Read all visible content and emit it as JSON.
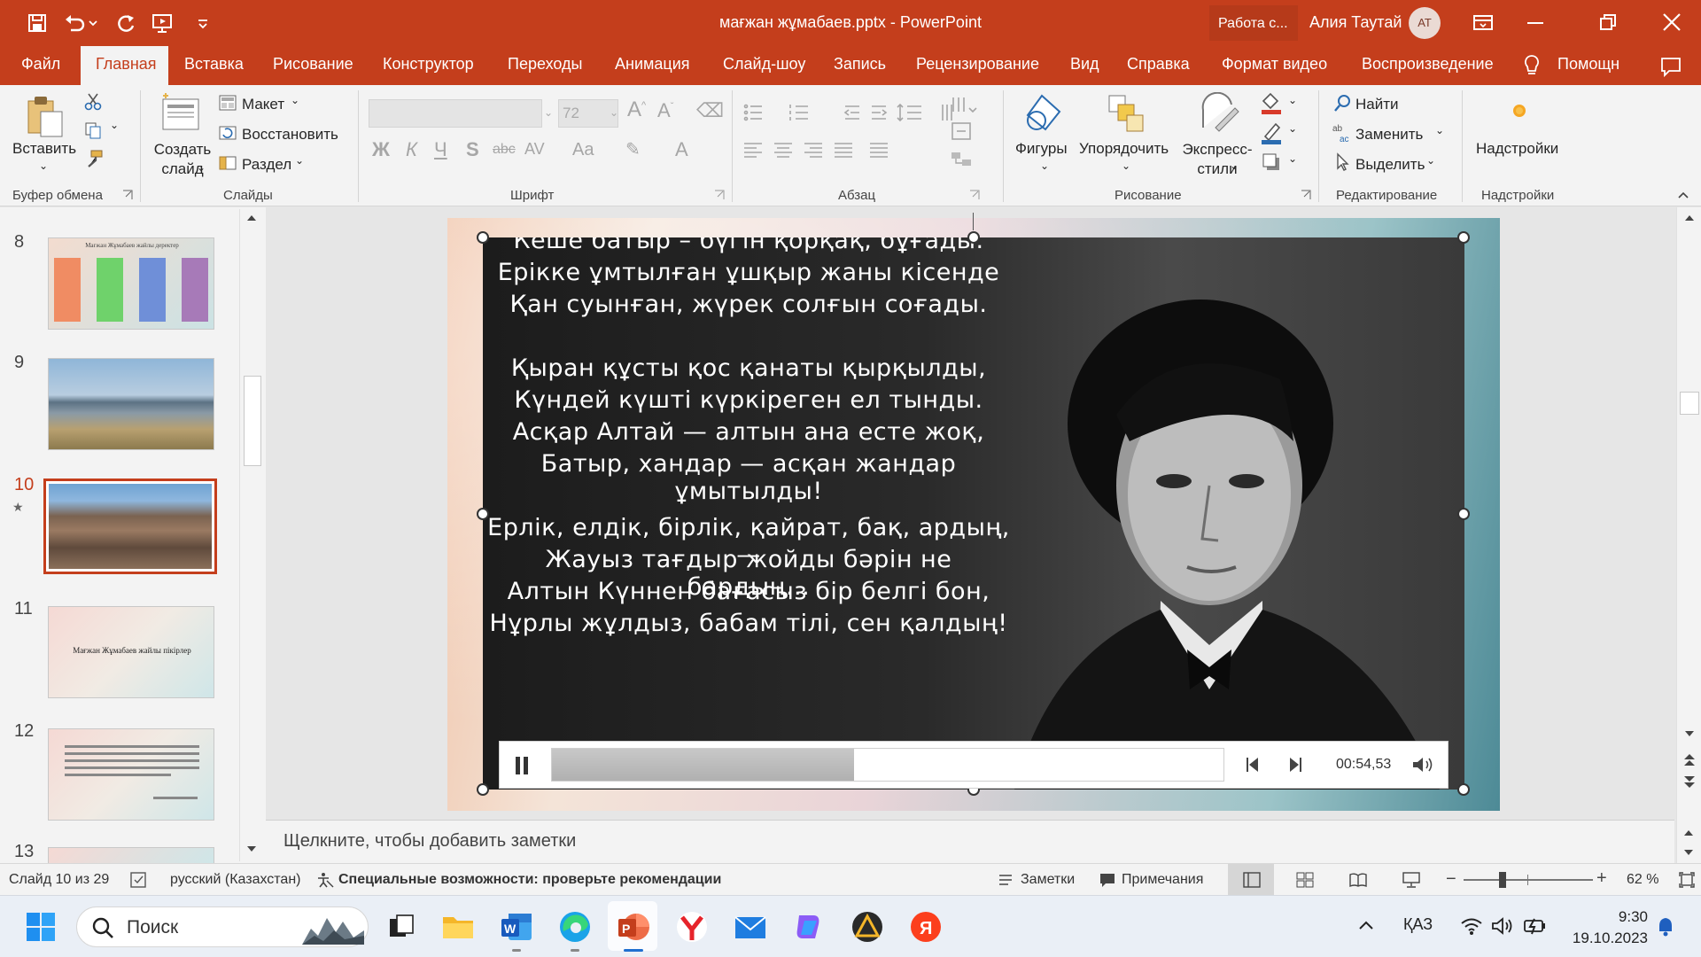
{
  "window": {
    "title": "мағжан жұмабаев.pptx  -  PowerPoint",
    "work_status": "Работа с...",
    "user_name": "Алия Таутай",
    "user_initials": "АТ"
  },
  "tabs": [
    "Файл",
    "Главная",
    "Вставка",
    "Рисование",
    "Конструктор",
    "Переходы",
    "Анимация",
    "Слайд-шоу",
    "Запись",
    "Рецензирование",
    "Вид",
    "Справка",
    "Формат видео",
    "Воспроизведение",
    "Помощн"
  ],
  "ribbon": {
    "clipboard": {
      "paste": "Вставить",
      "label": "Буфер обмена"
    },
    "slides": {
      "new_slide": "Создать слайд",
      "layout": "Макет",
      "reset": "Восстановить",
      "section": "Раздел",
      "label": "Слайды"
    },
    "font": {
      "font_size": "72",
      "bold": "Ж",
      "italic": "К",
      "underline": "Ч",
      "strike": "S",
      "strike_abc": "abc",
      "spacing": "AV",
      "case": "Aa",
      "label": "Шрифт"
    },
    "paragraph": {
      "label": "Абзац"
    },
    "drawing": {
      "shapes": "Фигуры",
      "arrange": "Упорядочить",
      "quick_styles": "Экспресс-стили",
      "label": "Рисование"
    },
    "editing": {
      "find": "Найти",
      "replace": "Заменить",
      "select": "Выделить",
      "label": "Редактирование"
    },
    "addins": {
      "addins": "Надстройки",
      "label": "Надстройки"
    }
  },
  "slides_panel": [
    {
      "num": "8",
      "title": "Мағжан Жұмабаев жайлы деректер"
    },
    {
      "num": "9"
    },
    {
      "num": "10",
      "selected": true
    },
    {
      "num": "11",
      "title": "Мағжан Жұмабаев жайлы пікірлер"
    },
    {
      "num": "12"
    },
    {
      "num": "13"
    }
  ],
  "poem_lines": [
    "Кеше батыр – бүгін қорқақ, бұғады.",
    "Ерікке ұмтылған ұшқыр жаны кісенде",
    "Қан суынған, жүрек солғын соғады.",
    "",
    "Қыран құсты қос қанаты қырқылды,",
    "Күндей күшті күркіреген ел тынды.",
    "Асқар Алтай — алтын ана есте жоқ,",
    "Батыр, хандар — асқан жандар ұмытылды!",
    "",
    "Ерлік, елдік, бірлік, қайрат, бақ, ардың, —",
    "Жауыз тағдыр жойды бәрін не бардың...",
    "Алтын Күннен бағасыз бір белгі бон,",
    "Нұрлы жұлдыз, бабам тілі, сен қалдың!"
  ],
  "video": {
    "time": "00:54,53",
    "progress_fraction": 0.45
  },
  "notes_placeholder": "Щелкните, чтобы добавить заметки",
  "status": {
    "slide_info": "Слайд 10 из 29",
    "language": "русский (Казахстан)",
    "accessibility": "Специальные возможности: проверьте рекомендации",
    "notes": "Заметки",
    "comments": "Примечания",
    "zoom": "62 %"
  },
  "taskbar": {
    "search_placeholder": "Поиск",
    "lang": "ҚАЗ",
    "time": "9:30",
    "date": "19.10.2023"
  }
}
